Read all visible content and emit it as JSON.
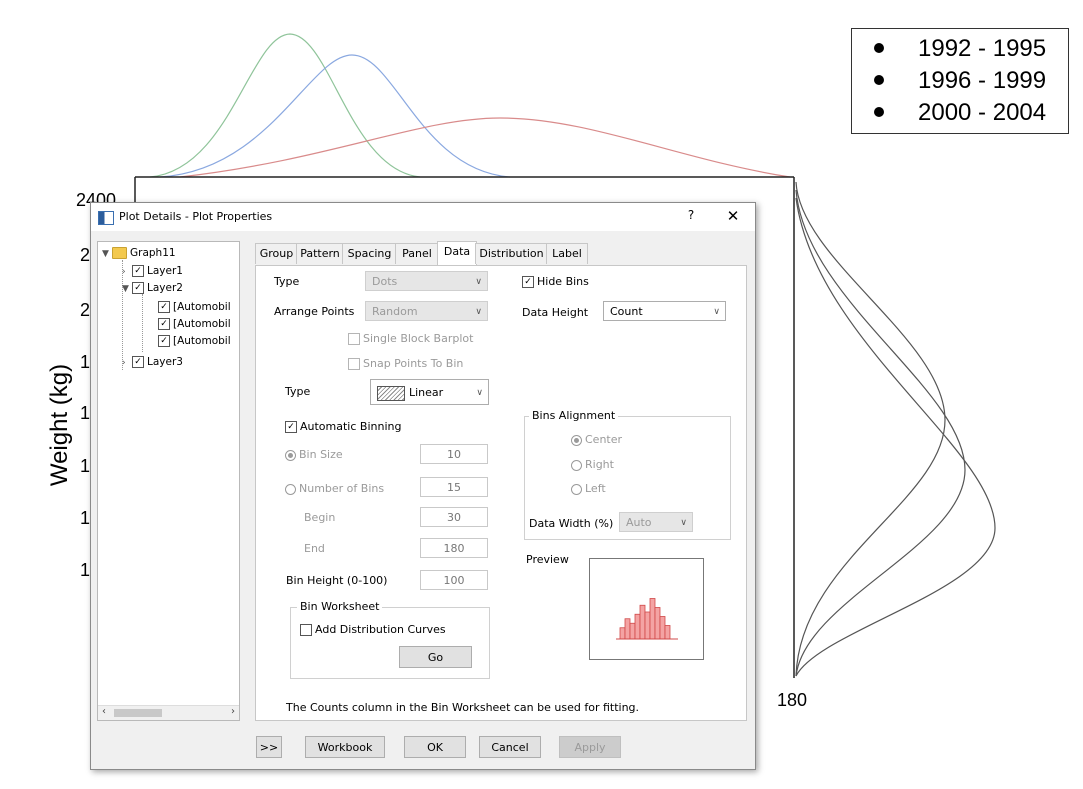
{
  "background_plot": {
    "legend": [
      "1992 - 1995",
      "1996 - 1999",
      "2000 - 2004"
    ],
    "ylabel": "Weight (kg)",
    "tick_top": "2400",
    "tick_bottom_right": "180",
    "partial_ticks": [
      "2",
      "2",
      "1",
      "1",
      "1",
      "1",
      "1"
    ],
    "curve_colors": [
      "#8fc49a",
      "#8aa8e0",
      "#d98b8b",
      "#555555"
    ]
  },
  "dialog": {
    "title": "Plot Details - Plot Properties",
    "help": "?",
    "close": "✕",
    "tree": {
      "root": "Graph11",
      "items": [
        "Layer1",
        "Layer2",
        "[Automobil",
        "[Automobil",
        "[Automobil",
        "Layer3"
      ]
    },
    "tabs": [
      "Group",
      "Pattern",
      "Spacing",
      "Panel",
      "Data",
      "Distribution",
      "Label"
    ],
    "active_tab": "Data",
    "data_tab": {
      "type_label": "Type",
      "type_value": "Dots",
      "arrange_label": "Arrange Points",
      "arrange_value": "Random",
      "single_block": "Single Block Barplot",
      "snap_points": "Snap Points To Bin",
      "hide_bins": "Hide Bins",
      "data_height_label": "Data Height",
      "data_height_value": "Count",
      "type2_label": "Type",
      "type2_value": "Linear",
      "auto_binning": "Automatic Binning",
      "bin_size_label": "Bin Size",
      "bin_size_value": "10",
      "num_bins_label": "Number of Bins",
      "num_bins_value": "15",
      "begin_label": "Begin",
      "begin_value": "30",
      "end_label": "End",
      "end_value": "180",
      "bin_height_label": "Bin Height (0-100)",
      "bin_height_value": "100",
      "bin_worksheet_title": "Bin Worksheet",
      "add_dist_curves": "Add Distribution Curves",
      "go": "Go",
      "bins_alignment_title": "Bins Alignment",
      "align_center": "Center",
      "align_right": "Right",
      "align_left": "Left",
      "data_width_label": "Data Width (%)",
      "data_width_value": "Auto",
      "preview_label": "Preview",
      "note": "The Counts column in the Bin Worksheet can be used for fitting."
    },
    "buttons": {
      "more": ">>",
      "workbook": "Workbook",
      "ok": "OK",
      "cancel": "Cancel",
      "apply": "Apply"
    },
    "preview_bars": [
      0.25,
      0.45,
      0.35,
      0.55,
      0.75,
      0.6,
      0.9,
      0.7,
      0.5,
      0.3
    ]
  }
}
